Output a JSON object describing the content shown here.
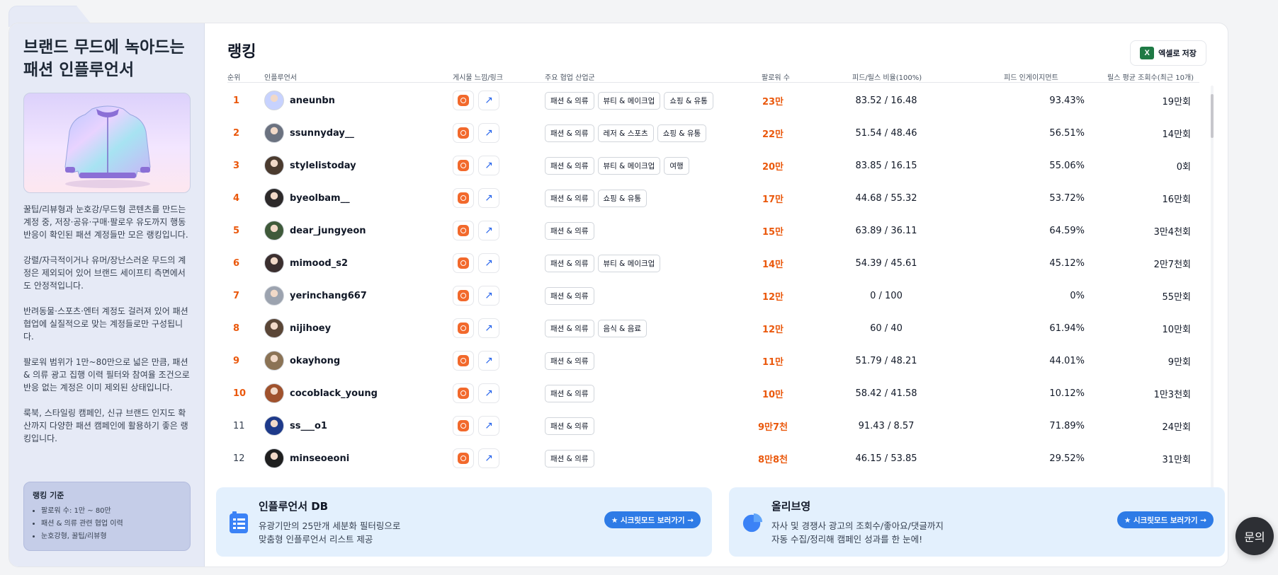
{
  "sidebar": {
    "title": "브랜드 무드에 녹아드는\n패션 인플루언서",
    "paragraphs": [
      "꿀팁/리뷰형과 눈호강/무드형 콘텐츠를 만드는 계정 중, 저장·공유·구매·팔로우 유도까지 행동 반응이 확인된 패션 계정들만 모은 랭킹입니다.",
      "강렬/자극적이거나 유머/장난스러운 무드의 계정은 제외되어 있어 브랜드 세이프티 측면에서도 안정적입니다.",
      "반려동물·스포츠·엔터 계정도 걸러져 있어 패션 협업에 실질적으로 맞는 계정들로만 구성됩니다.",
      "팔로워 범위가 1만~80만으로 넓은 만큼, 패션 & 의류 광고 집행 이력 필터와 참여율 조건으로 반응 없는 계정은 이미 제외된 상태입니다.",
      "룩북, 스타일링 캠페인, 신규 브랜드 인지도 확산까지 다양한 패션 캠페인에 활용하기 좋은 랭킹입니다."
    ],
    "criteria": {
      "title": "랭킹 기준",
      "items": [
        "팔로워 수: 1만 ~ 80만",
        "패션 & 의류 관련 협업 이력",
        "눈호강형, 꿀팁/리뷰형"
      ]
    }
  },
  "main": {
    "title": "랭킹",
    "excel_label": "엑셀로 저장",
    "columns": {
      "rank": "순위",
      "influencer": "인플루언서",
      "links": "게시물 느낌/링크",
      "industry": "주요 협업 산업군",
      "followers": "팔로워 수",
      "ratio": "피드/릴스 비율(100%)",
      "engagement": "피드 인게이지먼트",
      "views": "릴스 평균 조회수(최근 10개)"
    },
    "rows": [
      {
        "rank": "1",
        "name": "aneunbn",
        "tags": [
          "패션 & 의류",
          "뷰티 & 메이크업",
          "쇼핑 & 유통"
        ],
        "followers": "23만",
        "ratio": "83.52 / 16.48",
        "engagement": "93.43%",
        "views": "19만회"
      },
      {
        "rank": "2",
        "name": "ssunnyday__",
        "tags": [
          "패션 & 의류",
          "레저 & 스포츠",
          "쇼핑 & 유통"
        ],
        "followers": "22만",
        "ratio": "51.54 / 48.46",
        "engagement": "56.51%",
        "views": "14만회"
      },
      {
        "rank": "3",
        "name": "stylelistoday",
        "tags": [
          "패션 & 의류",
          "뷰티 & 메이크업",
          "여행"
        ],
        "followers": "20만",
        "ratio": "83.85 / 16.15",
        "engagement": "55.06%",
        "views": "0회"
      },
      {
        "rank": "4",
        "name": "byeolbam__",
        "tags": [
          "패션 & 의류",
          "쇼핑 & 유통"
        ],
        "followers": "17만",
        "ratio": "44.68 / 55.32",
        "engagement": "53.72%",
        "views": "16만회"
      },
      {
        "rank": "5",
        "name": "dear_jungyeon",
        "tags": [
          "패션 & 의류"
        ],
        "followers": "15만",
        "ratio": "63.89 / 36.11",
        "engagement": "64.59%",
        "views": "3만4천회"
      },
      {
        "rank": "6",
        "name": "mimood_s2",
        "tags": [
          "패션 & 의류",
          "뷰티 & 메이크업"
        ],
        "followers": "14만",
        "ratio": "54.39 / 45.61",
        "engagement": "45.12%",
        "views": "2만7천회"
      },
      {
        "rank": "7",
        "name": "yerinchang667",
        "tags": [
          "패션 & 의류"
        ],
        "followers": "12만",
        "ratio": "0 / 100",
        "engagement": "0%",
        "views": "55만회"
      },
      {
        "rank": "8",
        "name": "nijihoey",
        "tags": [
          "패션 & 의류",
          "음식 & 음료"
        ],
        "followers": "12만",
        "ratio": "60 / 40",
        "engagement": "61.94%",
        "views": "10만회"
      },
      {
        "rank": "9",
        "name": "okayhong",
        "tags": [
          "패션 & 의류"
        ],
        "followers": "11만",
        "ratio": "51.79 / 48.21",
        "engagement": "44.01%",
        "views": "9만회"
      },
      {
        "rank": "10",
        "name": "cocoblack_young",
        "tags": [
          "패션 & 의류"
        ],
        "followers": "10만",
        "ratio": "58.42 / 41.58",
        "engagement": "10.12%",
        "views": "1만3천회"
      },
      {
        "rank": "11",
        "name": "ss___o1",
        "tags": [
          "패션 & 의류"
        ],
        "followers": "9만7천",
        "ratio": "91.43 / 8.57",
        "engagement": "71.89%",
        "views": "24만회"
      },
      {
        "rank": "12",
        "name": "minseoeoni",
        "tags": [
          "패션 & 의류"
        ],
        "followers": "8만8천",
        "ratio": "46.15 / 53.85",
        "engagement": "29.52%",
        "views": "31만회"
      }
    ],
    "avatar_colors": [
      "#c7d2fe",
      "#6b7280",
      "#4b3b2f",
      "#2d2a2a",
      "#3f5a3a",
      "#3b2f2f",
      "#9ca3af",
      "#5a4636",
      "#8b7355",
      "#a0522d",
      "#1e3a8a",
      "#1f1f1f"
    ]
  },
  "promos": [
    {
      "title": "인플루언서 DB",
      "line1": "유광기만의 25만개 세분화 필터링으로",
      "line2": "맞춤형 인플루언서 리스트 제공",
      "cta": "★ 시크릿모드 보러가기 →"
    },
    {
      "title": "올리브영",
      "line1": "자사 및 경쟁사 광고의 조회수/좋아요/댓글까지",
      "line2": "자동 수집/정리해 캠페인 성과를 한 눈에!",
      "cta": "★ 시크릿모드 보러가기 →"
    }
  ],
  "chat_label": "문의",
  "colors": {
    "accent_orange": "#ea580c",
    "instagram": "#f2692c",
    "cta_blue": "#2e7be6",
    "promo_bg": "#e3f0fd",
    "sidebar_bg": "#e6eaf6"
  }
}
